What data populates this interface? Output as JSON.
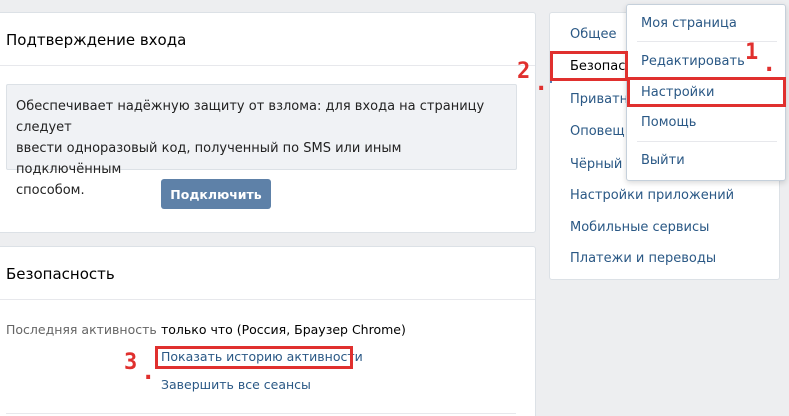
{
  "login_confirmation": {
    "title": "Подтверждение входа",
    "description_lines": [
      "Обеспечивает надёжную защиту от взлома: для входа на страницу следует",
      "ввести одноразовый код, полученный по SMS или иным подключённым",
      "способом."
    ],
    "connect_button": "Подключить"
  },
  "security": {
    "title": "Безопасность",
    "last_activity_label": "Последняя активность",
    "last_activity_value": "только что (Россия, Браузер Chrome)",
    "show_history_link": "Показать историю активности",
    "end_sessions_link": "Завершить все сеансы"
  },
  "settings_nav": {
    "items": [
      "Общее",
      "Безопасн",
      "Приватн",
      "Оповещ",
      "Чёрный с",
      "Настройки приложений",
      "Мобильные сервисы",
      "Платежи и переводы"
    ],
    "active_index": 1
  },
  "user_menu": {
    "items": [
      "Моя страница",
      "Редактировать",
      "Настройки",
      "Помощь",
      "Выйти"
    ]
  },
  "annotations": {
    "step1": "1",
    "step2": "2",
    "step3": "3",
    "dot": "."
  },
  "colors": {
    "accent": "#5e81a8",
    "link": "#2a5885",
    "annotation_red": "#e0302e"
  }
}
